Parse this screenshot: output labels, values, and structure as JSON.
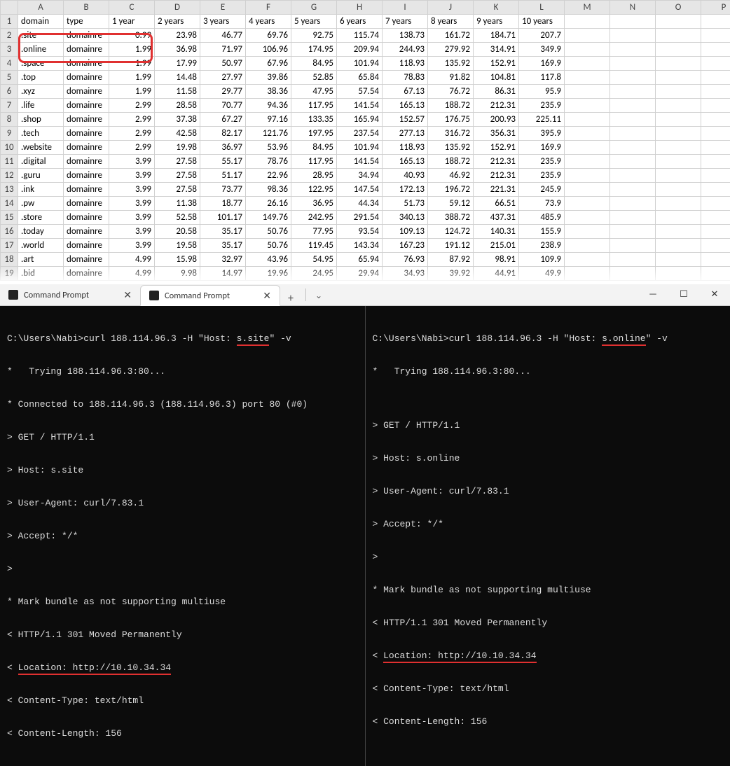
{
  "spreadsheet": {
    "columns": [
      "A",
      "B",
      "C",
      "D",
      "E",
      "F",
      "G",
      "H",
      "I",
      "J",
      "K",
      "L",
      "M",
      "N",
      "O",
      "P"
    ],
    "header_row": [
      "domain",
      "type",
      "1 year",
      "2 years",
      "3 years",
      "4 years",
      "5 years",
      "6 years",
      "7 years",
      "8 years",
      "9 years",
      "10 years",
      "",
      "",
      "",
      ""
    ],
    "rows": [
      [
        ".site",
        "domainre",
        "0.99",
        "23.98",
        "46.77",
        "69.76",
        "92.75",
        "115.74",
        "138.73",
        "161.72",
        "184.71",
        "207.7",
        "",
        "",
        "",
        ""
      ],
      [
        ".online",
        "domainre",
        "1.99",
        "36.98",
        "71.97",
        "106.96",
        "174.95",
        "209.94",
        "244.93",
        "279.92",
        "314.91",
        "349.9",
        "",
        "",
        "",
        ""
      ],
      [
        ".space",
        "domainre",
        "1.99",
        "17.99",
        "50.97",
        "67.96",
        "84.95",
        "101.94",
        "118.93",
        "135.92",
        "152.91",
        "169.9",
        "",
        "",
        "",
        ""
      ],
      [
        ".top",
        "domainre",
        "1.99",
        "14.48",
        "27.97",
        "39.86",
        "52.85",
        "65.84",
        "78.83",
        "91.82",
        "104.81",
        "117.8",
        "",
        "",
        "",
        ""
      ],
      [
        ".xyz",
        "domainre",
        "1.99",
        "11.58",
        "29.77",
        "38.36",
        "47.95",
        "57.54",
        "67.13",
        "76.72",
        "86.31",
        "95.9",
        "",
        "",
        "",
        ""
      ],
      [
        ".life",
        "domainre",
        "2.99",
        "28.58",
        "70.77",
        "94.36",
        "117.95",
        "141.54",
        "165.13",
        "188.72",
        "212.31",
        "235.9",
        "",
        "",
        "",
        ""
      ],
      [
        ".shop",
        "domainre",
        "2.99",
        "37.38",
        "67.27",
        "97.16",
        "133.35",
        "165.94",
        "152.57",
        "176.75",
        "200.93",
        "225.11",
        "",
        "",
        "",
        ""
      ],
      [
        ".tech",
        "domainre",
        "2.99",
        "42.58",
        "82.17",
        "121.76",
        "197.95",
        "237.54",
        "277.13",
        "316.72",
        "356.31",
        "395.9",
        "",
        "",
        "",
        ""
      ],
      [
        ".website",
        "domainre",
        "2.99",
        "19.98",
        "36.97",
        "53.96",
        "84.95",
        "101.94",
        "118.93",
        "135.92",
        "152.91",
        "169.9",
        "",
        "",
        "",
        ""
      ],
      [
        ".digital",
        "domainre",
        "3.99",
        "27.58",
        "55.17",
        "78.76",
        "117.95",
        "141.54",
        "165.13",
        "188.72",
        "212.31",
        "235.9",
        "",
        "",
        "",
        ""
      ],
      [
        ".guru",
        "domainre",
        "3.99",
        "27.58",
        "51.17",
        "22.96",
        "28.95",
        "34.94",
        "40.93",
        "46.92",
        "212.31",
        "235.9",
        "",
        "",
        "",
        ""
      ],
      [
        ".ink",
        "domainre",
        "3.99",
        "27.58",
        "73.77",
        "98.36",
        "122.95",
        "147.54",
        "172.13",
        "196.72",
        "221.31",
        "245.9",
        "",
        "",
        "",
        ""
      ],
      [
        ".pw",
        "domainre",
        "3.99",
        "11.38",
        "18.77",
        "26.16",
        "36.95",
        "44.34",
        "51.73",
        "59.12",
        "66.51",
        "73.9",
        "",
        "",
        "",
        ""
      ],
      [
        ".store",
        "domainre",
        "3.99",
        "52.58",
        "101.17",
        "149.76",
        "242.95",
        "291.54",
        "340.13",
        "388.72",
        "437.31",
        "485.9",
        "",
        "",
        "",
        ""
      ],
      [
        ".today",
        "domainre",
        "3.99",
        "20.58",
        "35.17",
        "50.76",
        "77.95",
        "93.54",
        "109.13",
        "124.72",
        "140.31",
        "155.9",
        "",
        "",
        "",
        ""
      ],
      [
        ".world",
        "domainre",
        "3.99",
        "19.58",
        "35.17",
        "50.76",
        "119.45",
        "143.34",
        "167.23",
        "191.12",
        "215.01",
        "238.9",
        "",
        "",
        "",
        ""
      ],
      [
        ".art",
        "domainre",
        "4.99",
        "15.98",
        "32.97",
        "43.96",
        "54.95",
        "65.94",
        "76.93",
        "87.92",
        "98.91",
        "109.9",
        "",
        "",
        "",
        ""
      ],
      [
        ".bid",
        "domainre",
        "4.99",
        "9.98",
        "14.97",
        "19.96",
        "24.95",
        "29.94",
        "34.93",
        "39.92",
        "44.91",
        "49.9",
        "",
        "",
        "",
        ""
      ]
    ]
  },
  "tabs": [
    {
      "title": "Command Prompt",
      "active": false
    },
    {
      "title": "Command Prompt",
      "active": true
    }
  ],
  "tabbar": {
    "add": "+",
    "dropdown": "⌄",
    "min": "—",
    "max": "☐",
    "close": "✕"
  },
  "term": {
    "left": {
      "cmd": "C:\\Users\\Nabi>curl 188.114.96.3 -H \"Host: s.site\" -v",
      "host_highlight": "s.site",
      "lines_pre": "C:\\Users\\Nabi>curl 188.114.96.3 -H \"Host: ",
      "lines_post": "\" -v",
      "l1": "*   Trying 188.114.96.3:80...",
      "l2": "* Connected to 188.114.96.3 (188.114.96.3) port 80 (#0)",
      "l3": "> GET / HTTP/1.1",
      "l4": "> Host: s.site",
      "l5": "> User-Agent: curl/7.83.1",
      "l6": "> Accept: */*",
      "l7": ">",
      "l8": "* Mark bundle as not supporting multiuse",
      "l9": "< HTTP/1.1 301 Moved Permanently",
      "l10_pre": "< ",
      "l10_hl": "Location: http://10.10.34.34",
      "l11": "< Content-Type: text/html",
      "l12": "< Content-Length: 156"
    },
    "right": {
      "lines_pre": "C:\\Users\\Nabi>curl 188.114.96.3 -H \"Host: ",
      "host_highlight": "s.online",
      "lines_post": "\" -v",
      "l1": "*   Trying 188.114.96.3:80...",
      "l2": "",
      "l3": "> GET / HTTP/1.1",
      "l4": "> Host: s.online",
      "l5": "> User-Agent: curl/7.83.1",
      "l6": "> Accept: */*",
      "l7": ">",
      "l8": "* Mark bundle as not supporting multiuse",
      "l9": "< HTTP/1.1 301 Moved Permanently",
      "l10_pre": "< ",
      "l10_hl": "Location: http://10.10.34.34",
      "l11": "< Content-Type: text/html",
      "l12": "< Content-Length: 156"
    }
  }
}
